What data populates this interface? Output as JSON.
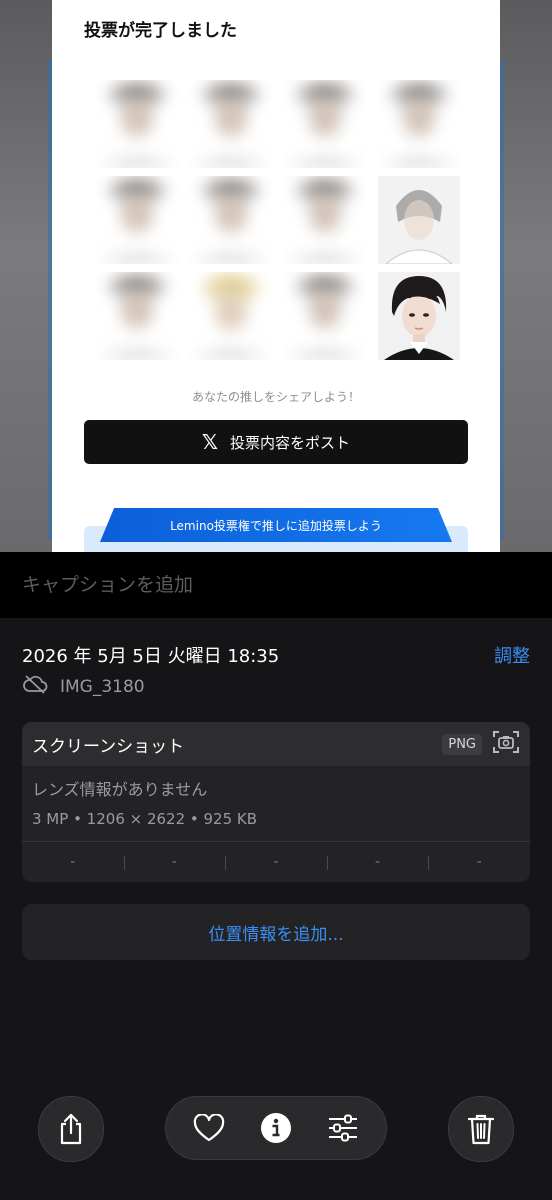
{
  "preview": {
    "title": "投票が完了しました",
    "share_hint": "あなたの推しをシェアしよう！",
    "post_button": "投票内容をポスト",
    "post_icon": "x-logo-icon",
    "lemino_banner": "Lemino投票権で推しに追加投票しよう"
  },
  "caption": {
    "placeholder": "キャプションを追加"
  },
  "info": {
    "datetime": "2026 年 5月 5日 火曜日 18:35",
    "adjust": "調整",
    "filename": "IMG_3180",
    "card_title": "スクリーンショット",
    "format_badge": "PNG",
    "lens": "レンズ情報がありません",
    "specs": "3 MP • 1206 × 2622 • 925 KB",
    "exif": [
      "-",
      "-",
      "-",
      "-",
      "-"
    ],
    "location_button": "位置情報を追加..."
  },
  "toolbar": {
    "share": "share-icon",
    "favorite": "heart-icon",
    "info": "info-icon",
    "adjust": "sliders-icon",
    "delete": "trash-icon"
  },
  "colors": {
    "accent": "#3a8ff5",
    "background": "#151517"
  }
}
